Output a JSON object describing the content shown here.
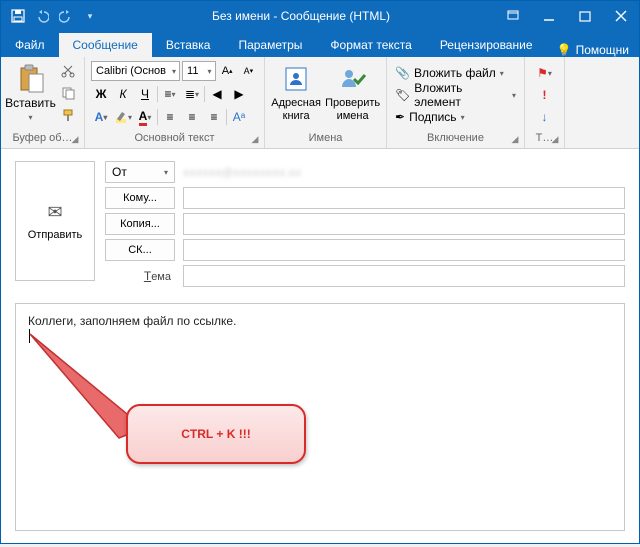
{
  "titlebar": {
    "title": "Без имени - Сообщение (HTML)"
  },
  "tabs": {
    "file": "Файл",
    "message": "Сообщение",
    "insert": "Вставка",
    "options": "Параметры",
    "format": "Формат текста",
    "review": "Рецензирование",
    "help": "Помощни"
  },
  "ribbon": {
    "clipboard": {
      "label": "Буфер об…",
      "paste": "Вставить"
    },
    "font": {
      "label": "Основной текст",
      "family": "Calibri (Основ",
      "size": "11",
      "bold": "Ж",
      "italic": "К",
      "underline": "Ч"
    },
    "names": {
      "label": "Имена",
      "addressbook": "Адресная\nкнига",
      "checknames": "Проверить\nимена"
    },
    "include": {
      "label": "Включение",
      "attachfile": "Вложить файл",
      "attachitem": "Вложить элемент",
      "signature": "Подпись"
    },
    "tags": {
      "label": "Т…"
    }
  },
  "compose": {
    "send": "Отправить",
    "from": "От",
    "fromvalue": "ⅹⅹⅹⅹⅹⅹ@ⅹⅹⅹⅹⅹⅹⅹⅹ.ⅹⅹ",
    "to": "Кому...",
    "cc": "Копия...",
    "bcc": "СК...",
    "subject": "Тема"
  },
  "body": {
    "text": "Коллеги, заполняем файл по ссылке."
  },
  "annotation": {
    "text": "CTRL + K !!!"
  }
}
